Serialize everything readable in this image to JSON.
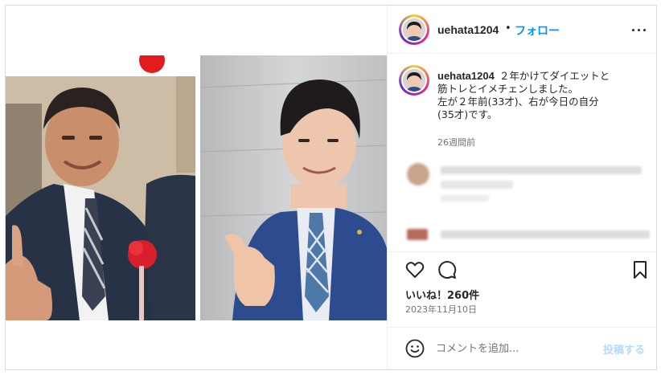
{
  "post": {
    "username": "uehata1204",
    "separator": "•",
    "follow_label": "フォロー",
    "caption_line1": "２年かけてダイエットと",
    "caption_line2": "筋トレとイメチェンしました。",
    "caption_line3": "左が２年前(33才)、右が今日の自分",
    "caption_line4": "(35才)です。",
    "caption_time": "26週間前",
    "likes_label": "いいね！260件",
    "date_label": "2023年11月10日"
  },
  "comment": {
    "placeholder": "コメントを追加...",
    "post_label": "投稿する"
  },
  "icons": {
    "more": "more-options-icon",
    "like": "heart-icon",
    "comment": "comment-bubble-icon",
    "save": "bookmark-icon",
    "emoji": "emoji-icon"
  },
  "colors": {
    "accent": "#0095f6",
    "text": "#262626",
    "muted": "#737373",
    "border": "#dbdbdb",
    "post_disabled": "#b3dbff"
  }
}
